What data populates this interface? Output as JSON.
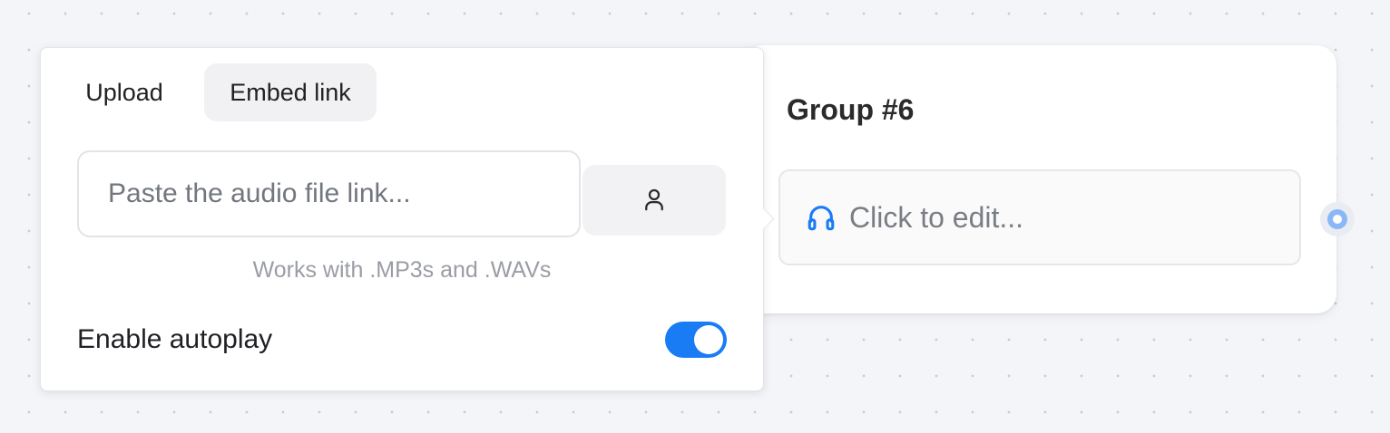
{
  "group": {
    "title": "Group #6",
    "audio_block": {
      "icon": "headphones-icon",
      "placeholder": "Click to edit..."
    }
  },
  "popover": {
    "tabs": [
      {
        "label": "Upload",
        "active": false
      },
      {
        "label": "Embed link",
        "active": true
      }
    ],
    "link_input": {
      "value": "",
      "placeholder": "Paste the audio file link..."
    },
    "side_button_icon": "user-icon",
    "hint": "Works with .MP3s and .WAVs",
    "autoplay": {
      "label": "Enable autoplay",
      "enabled": true
    }
  },
  "colors": {
    "accent": "#1a7cf5",
    "canvas_background": "#f4f5f8",
    "connector": "#8ab8f7"
  }
}
